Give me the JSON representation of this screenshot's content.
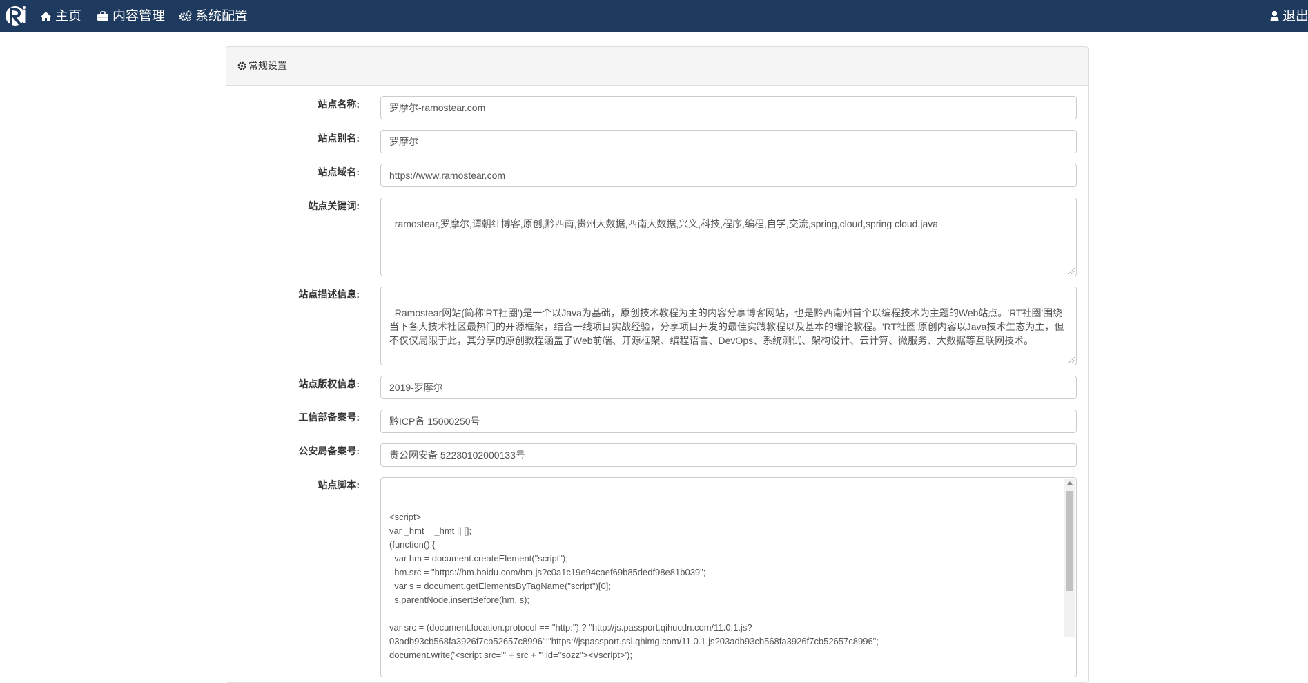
{
  "nav": {
    "home": "主页",
    "content": "内容管理",
    "system": "系统配置",
    "logout": "退出"
  },
  "panel": {
    "title": "常规设置"
  },
  "form": {
    "site_name": {
      "label": "站点名称:",
      "value": "罗摩尔-ramostear.com"
    },
    "site_alias": {
      "label": "站点别名:",
      "value": "罗摩尔"
    },
    "site_domain": {
      "label": "站点域名:",
      "value": "https://www.ramostear.com"
    },
    "site_keywords": {
      "label": "站点关键词:",
      "value": "ramostear,罗摩尔,谭朝红博客,原创,黔西南,贵州大数据,西南大数据,兴义,科技,程序,编程,自学,交流,spring,cloud,spring cloud,java"
    },
    "site_description": {
      "label": "站点描述信息:",
      "value": "Ramostear网站(简称'RT社圈')是一个以Java为基础，原创技术教程为主的内容分享博客网站，也是黔西南州首个以编程技术为主题的Web站点。'RT社圈'围绕当下各大技术社区最热门的开源框架，结合一线项目实战经验，分享项目开发的最佳实践教程以及基本的理论教程。'RT社圈'原创内容以Java技术生态为主，但不仅仅局限于此，其分享的原创教程涵盖了Web前端、开源框架、编程语言、DevOps、系统测试、架构设计、云计算、微服务、大数据等互联网技术。"
    },
    "site_copyright": {
      "label": "站点版权信息:",
      "value": "2019-罗摩尔"
    },
    "icp_record": {
      "label": "工信部备案号:",
      "value": "黔ICP备 15000250号"
    },
    "police_record": {
      "label": "公安局备案号:",
      "value": "贵公网安备 52230102000133号"
    },
    "site_script": {
      "label": "站点脚本:",
      "value": "<script>\nvar _hmt = _hmt || [];\n(function() {\n  var hm = document.createElement(\"script\");\n  hm.src = \"https://hm.baidu.com/hm.js?c0a1c19e94caef69b85dedf98e81b039\";\n  var s = document.getElementsByTagName(\"script\")[0];\n  s.parentNode.insertBefore(hm, s);\n\nvar src = (document.location.protocol == \"http:\") ? \"http://js.passport.qihucdn.com/11.0.1.js?\n03adb93cb568fa3926f7cb52657c8996\":\"https://jspassport.ssl.qhimg.com/11.0.1.js?03adb93cb568fa3926f7cb52657c8996\";\ndocument.write('<script src=\"' + src + '\" id=\"sozz\"><\\/script>');\n\n  var bp = document.createElement('script');"
    }
  }
}
